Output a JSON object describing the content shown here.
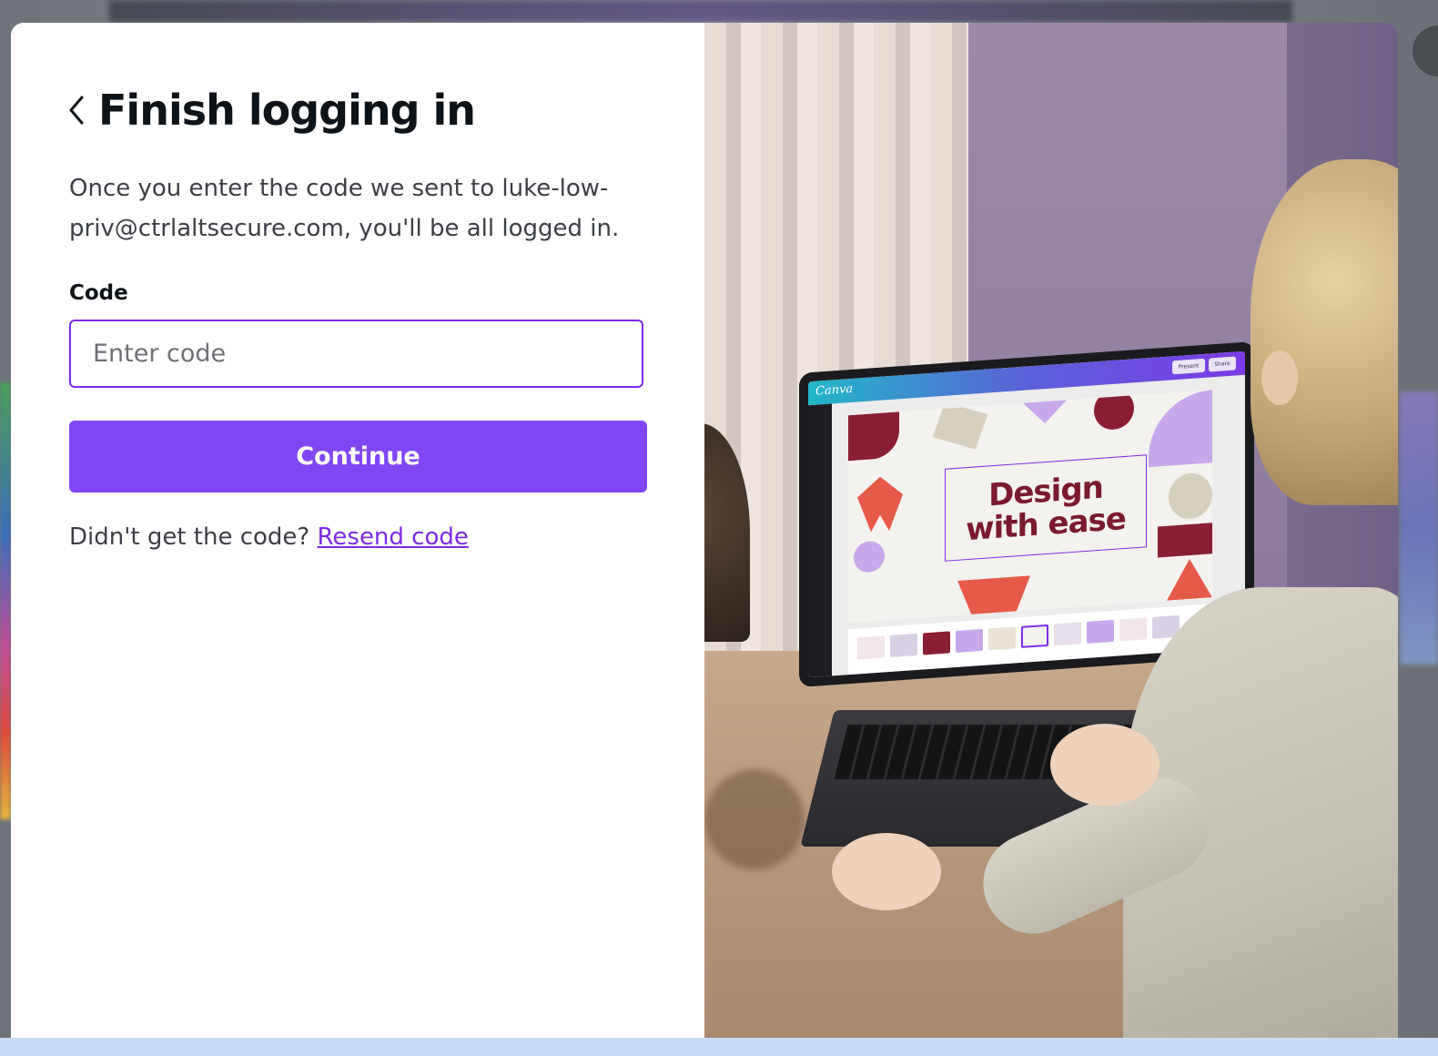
{
  "dialog": {
    "title": "Finish logging in",
    "description": "Once you enter the code we sent to luke-low-priv@ctrlaltsecure.com, you'll be all logged in.",
    "code_label": "Code",
    "code_placeholder": "Enter code",
    "code_value": "",
    "continue_label": "Continue",
    "resend_prompt": "Didn't get the code?",
    "resend_link": "Resend code"
  },
  "hero": {
    "app_logo": "Canva",
    "canvas_headline_line1": "Design",
    "canvas_headline_line2": "with ease",
    "topbar_present": "Present",
    "topbar_share": "Share"
  },
  "colors": {
    "accent": "#8046f3",
    "accent_border": "#7d2ae8",
    "link": "#7d2ae8",
    "title_text": "#0e1318",
    "body_text": "#3b3f45",
    "headline_maroon": "#7b1a2e"
  },
  "icons": {
    "back": "chevron-left-icon"
  }
}
